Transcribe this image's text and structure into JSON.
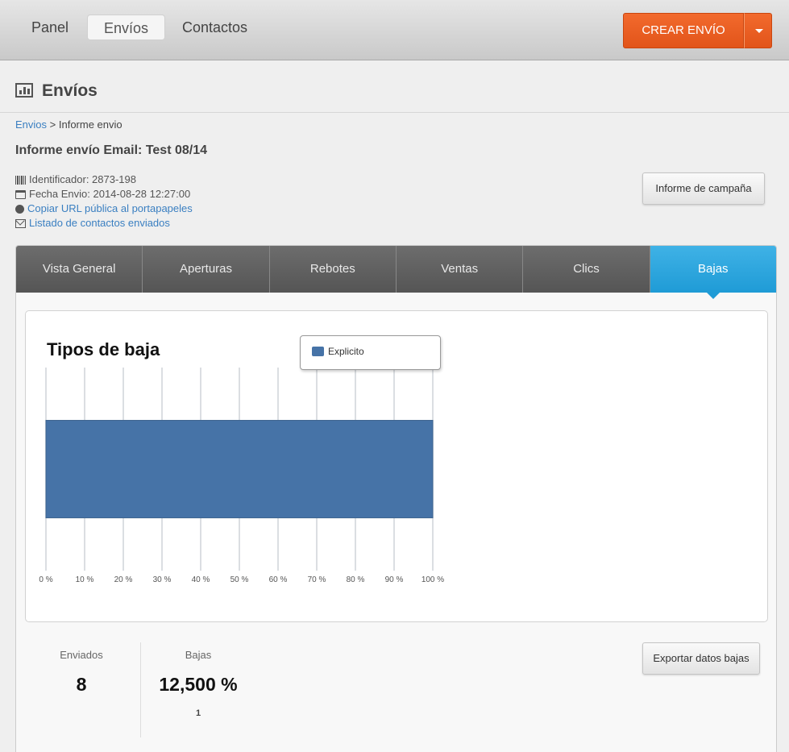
{
  "nav": {
    "items": [
      {
        "label": "Panel",
        "active": false
      },
      {
        "label": "Envíos",
        "active": true
      },
      {
        "label": "Contactos",
        "active": false
      }
    ],
    "create_label": "CREAR ENVÍO"
  },
  "header": {
    "title": "Envíos",
    "icon": "bar-chart-icon"
  },
  "breadcrumb": {
    "link": "Envios",
    "separator": " > ",
    "current": "Informe envio"
  },
  "report": {
    "title": "Informe envío Email: Test 08/14",
    "identifier": "Identificador: 2873-198",
    "send_date": "Fecha Envio: 2014-08-28 12:27:00",
    "copy_url_link": "Copiar URL pública al portapapeles",
    "contacts_link": "Listado de contactos enviados",
    "campaign_button": "Informe de campaña"
  },
  "tabs": [
    {
      "label": "Vista General"
    },
    {
      "label": "Aperturas"
    },
    {
      "label": "Rebotes"
    },
    {
      "label": "Ventas"
    },
    {
      "label": "Clics"
    },
    {
      "label": "Bajas",
      "active": true
    }
  ],
  "chart_data": {
    "type": "bar",
    "orientation": "horizontal",
    "title": "Tipos de baja",
    "categories": [
      ""
    ],
    "series": [
      {
        "name": "Explicito",
        "values": [
          100
        ]
      }
    ],
    "xlim": [
      0,
      100
    ],
    "x_ticks": [
      "0 %",
      "10 %",
      "20 %",
      "30 %",
      "40 %",
      "50 %",
      "60 %",
      "70 %",
      "80 %",
      "90 %",
      "100 %"
    ],
    "grid": true,
    "legend": "top-right",
    "color": "#4673a7"
  },
  "stats": {
    "sent_label": "Enviados",
    "sent_value": "8",
    "unsub_label": "Bajas",
    "unsub_value": "12,500 %",
    "unsub_count": "1",
    "export_button": "Exportar datos bajas"
  },
  "colors": {
    "accent": "#1f9bd6",
    "cta": "#e2541a",
    "link": "#3a7fc1"
  }
}
